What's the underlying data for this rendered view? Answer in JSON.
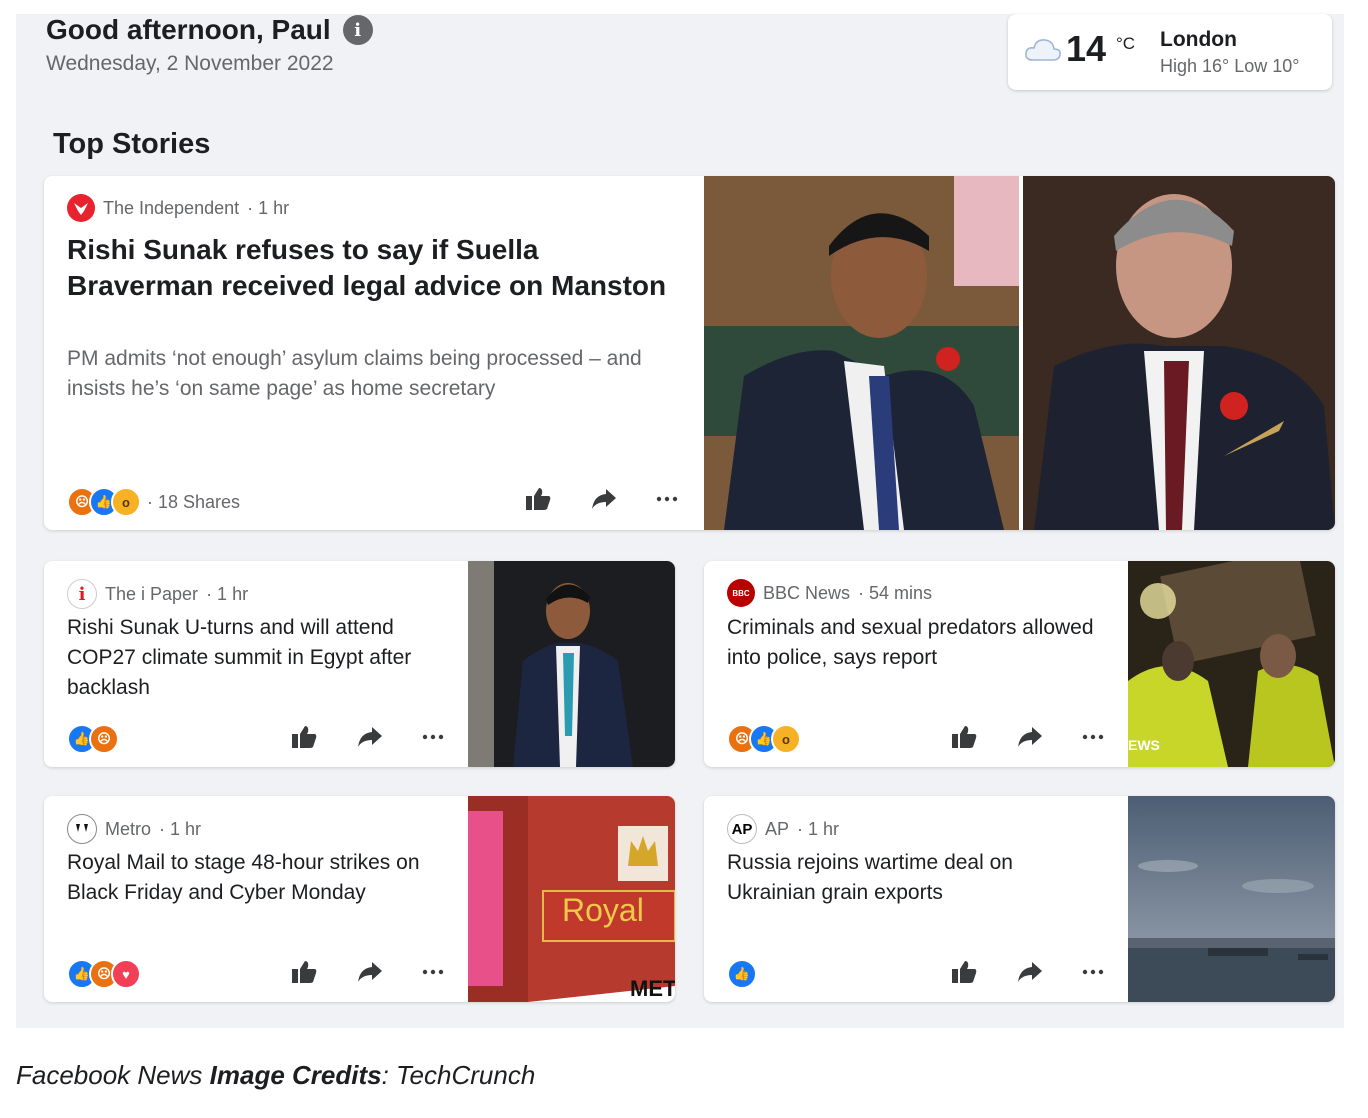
{
  "header": {
    "greeting": "Good afternoon, Paul",
    "date": "Wednesday, 2 November 2022"
  },
  "weather": {
    "icon": "cloud-icon",
    "temperature": "14",
    "unit": "°C",
    "city": "London",
    "high_low": "High 16° Low 10°"
  },
  "section_title": "Top Stories",
  "stories": [
    {
      "source": "The Independent",
      "time": "· 1 hr",
      "headline": "Rishi Sunak refuses to say if Suella Braverman received legal advice on Manston",
      "subtitle": "PM admits ‘not enough’ asylum claims being processed – and insists he’s ‘on same page’ as home secretary",
      "reactions": [
        "angry",
        "like",
        "wow"
      ],
      "shares": "· 18 Shares"
    },
    {
      "source": "The i Paper",
      "time": "· 1 hr",
      "headline": "Rishi Sunak U-turns and will attend COP27 climate summit in Egypt after backlash",
      "reactions": [
        "like",
        "angry"
      ]
    },
    {
      "source": "BBC News",
      "time": "· 54 mins",
      "headline": "Criminals and sexual predators allowed into police, says report",
      "reactions": [
        "angry",
        "like",
        "wow"
      ],
      "image_text": "EWS"
    },
    {
      "source": "Metro",
      "time": "· 1 hr",
      "headline": "Royal Mail to stage 48-hour strikes on Black Friday and Cyber Monday",
      "reactions": [
        "like",
        "angry",
        "love"
      ],
      "image_text": "Royal",
      "image_text2": "MET"
    },
    {
      "source": "AP",
      "time": "· 1 hr",
      "headline": "Russia rejoins wartime deal on Ukrainian grain exports",
      "reactions": [
        "like"
      ]
    }
  ],
  "logos": {
    "bbc": "BBC",
    "ap": "AP",
    "ipaper": "i"
  },
  "caption": {
    "prefix": "Facebook News ",
    "bold": "Image Credits",
    "suffix": ": TechCrunch"
  },
  "colors": {
    "background": "#f0f2f5",
    "card": "#ffffff",
    "like": "#1877f2",
    "angry": "#e9710f",
    "wow": "#f7b125",
    "love": "#f33e58"
  }
}
